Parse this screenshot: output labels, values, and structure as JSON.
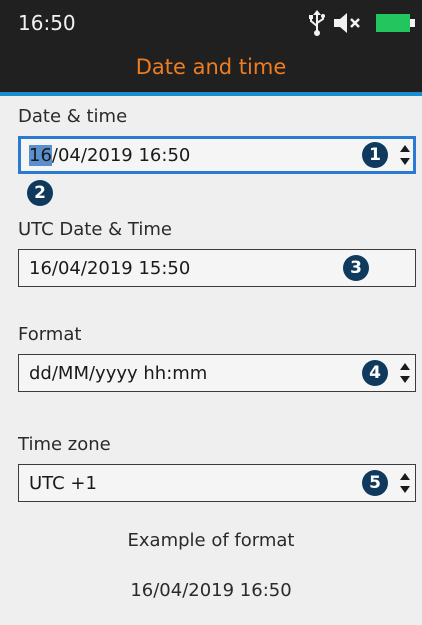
{
  "status": {
    "time": "16:50",
    "icons": [
      "usb-icon",
      "mute-icon",
      "battery-icon"
    ],
    "battery_color": "#22c55e"
  },
  "header": {
    "title": "Date and time",
    "accent": "#ef7d1f",
    "underline": "#1a8fd0"
  },
  "fields": {
    "datetime": {
      "label": "Date & time",
      "selected_part": "16",
      "value_rest": "/04/2019 16:50",
      "badge": "1"
    },
    "cursor_badge": "2",
    "utc": {
      "label": "UTC Date & Time",
      "value": "16/04/2019 15:50",
      "badge": "3"
    },
    "format": {
      "label": "Format",
      "value": "dd/MM/yyyy hh:mm",
      "badge": "4"
    },
    "timezone": {
      "label": "Time zone",
      "value": "UTC +1",
      "badge": "5"
    }
  },
  "example": {
    "label": "Example of format",
    "value": "16/04/2019 16:50"
  }
}
